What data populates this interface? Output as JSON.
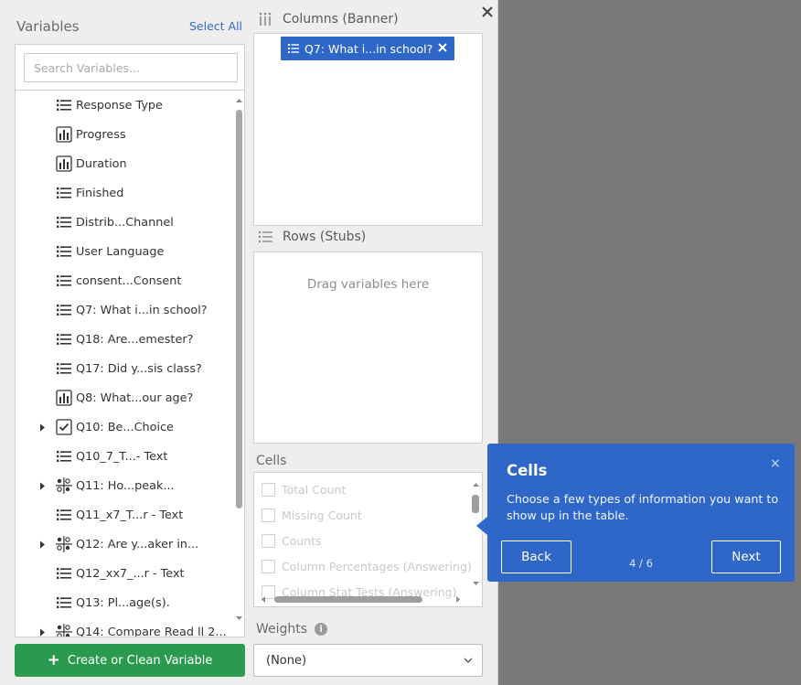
{
  "variables_panel": {
    "title": "Variables",
    "select_all": "Select All",
    "search_placeholder": "Search Variables...",
    "items": [
      {
        "label": "Response Type",
        "icon": "list-icon",
        "expandable": false
      },
      {
        "label": "Progress",
        "icon": "bar-chart-icon",
        "expandable": false
      },
      {
        "label": "Duration",
        "icon": "bar-chart-icon",
        "expandable": false
      },
      {
        "label": "Finished",
        "icon": "list-icon",
        "expandable": false
      },
      {
        "label": "Distrib...Channel",
        "icon": "list-icon",
        "expandable": false
      },
      {
        "label": "User Language",
        "icon": "list-icon",
        "expandable": false
      },
      {
        "label": "consent...Consent",
        "icon": "list-icon",
        "expandable": false
      },
      {
        "label": "Q7: What i...in school?",
        "icon": "list-icon",
        "expandable": false
      },
      {
        "label": "Q18: Are...emester?",
        "icon": "list-icon",
        "expandable": false
      },
      {
        "label": "Q17: Did y...sis class?",
        "icon": "list-icon",
        "expandable": false
      },
      {
        "label": "Q8: What...our age?",
        "icon": "bar-chart-icon",
        "expandable": false
      },
      {
        "label": "Q10: Be...Choice",
        "icon": "checkbox-icon",
        "expandable": true
      },
      {
        "label": "Q10_7_T...- Text",
        "icon": "list-icon",
        "expandable": false
      },
      {
        "label": "Q11: Ho...peak...",
        "icon": "matrix-icon",
        "expandable": true
      },
      {
        "label": "Q11_x7_T...r - Text",
        "icon": "list-icon",
        "expandable": false
      },
      {
        "label": "Q12: Are y...aker in...",
        "icon": "matrix-icon",
        "expandable": true
      },
      {
        "label": "Q12_xx7_...r - Text",
        "icon": "list-icon",
        "expandable": false
      },
      {
        "label": "Q13: Pl...age(s).",
        "icon": "list-icon",
        "expandable": false
      },
      {
        "label": "Q14: Compare Read ll 2...",
        "icon": "matrix-icon",
        "expandable": true
      }
    ]
  },
  "create_button": "Create or Clean Variable",
  "columns": {
    "title": "Columns (Banner)",
    "chip_label": "Q7: What i...in school?"
  },
  "rows": {
    "title": "Rows (Stubs)",
    "placeholder": "Drag variables here"
  },
  "cells": {
    "title": "Cells",
    "options": [
      "Total Count",
      "Missing Count",
      "Counts",
      "Column Percentages (Answering)",
      "Column Stat Tests (Answering)"
    ]
  },
  "weights": {
    "title": "Weights",
    "value": "(None)"
  },
  "tooltip": {
    "title": "Cells",
    "body": "Choose a few types of information you want to show up in the table.",
    "back": "Back",
    "next": "Next",
    "step": "4 / 6",
    "close": "×"
  },
  "colors": {
    "accent": "#2f67c9",
    "create_button": "#2a9a4e",
    "link": "#2f6bc7"
  }
}
